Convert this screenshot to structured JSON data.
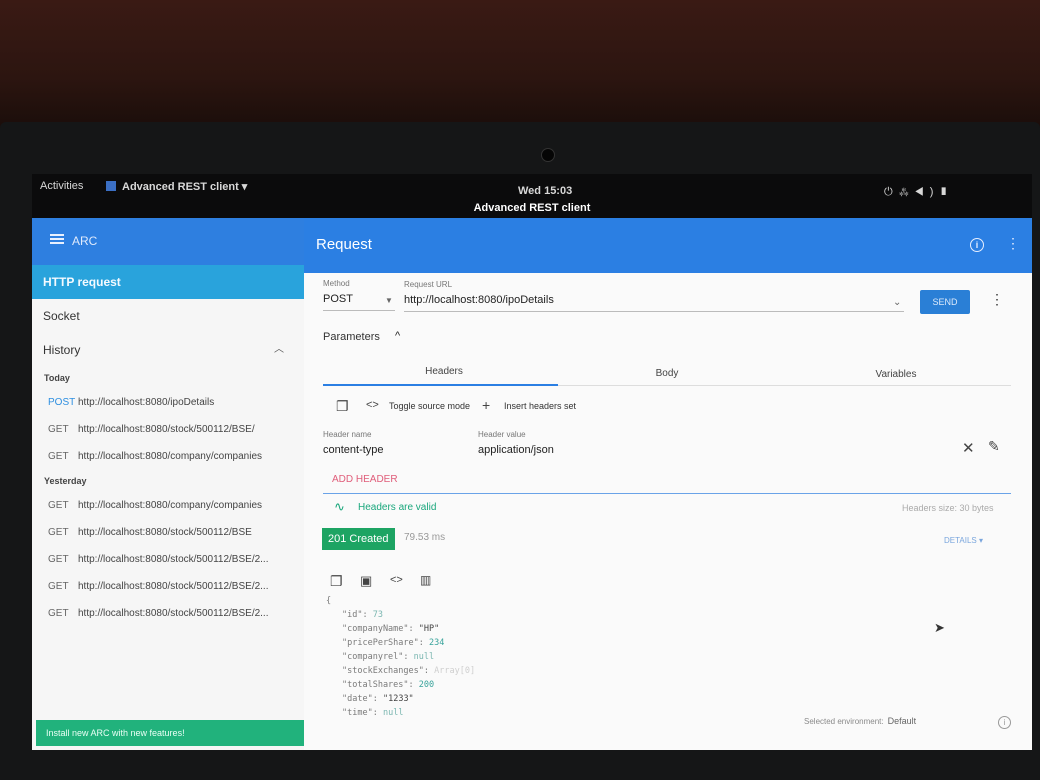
{
  "system_bar": {
    "activities": "Activities",
    "app_menu": "Advanced REST client ▾",
    "clock": "Wed 15:03",
    "window_title": "Advanced REST client",
    "tray_icons": [
      "power-icon",
      "network-icon",
      "volume-icon",
      "battery-icon"
    ]
  },
  "sidebar": {
    "brand": "ARC",
    "items": [
      {
        "label": "HTTP request",
        "active": true
      },
      {
        "label": "Socket",
        "active": false
      }
    ],
    "history_label": "History",
    "groups": [
      {
        "label": "Today",
        "rows": [
          {
            "method": "POST",
            "url": "http://localhost:8080/ipoDetails"
          },
          {
            "method": "GET",
            "url": "http://localhost:8080/stock/500112/BSE/"
          },
          {
            "method": "GET",
            "url": "http://localhost:8080/company/companies"
          }
        ]
      },
      {
        "label": "Yesterday",
        "rows": [
          {
            "method": "GET",
            "url": "http://localhost:8080/company/companies"
          },
          {
            "method": "GET",
            "url": "http://localhost:8080/stock/500112/BSE"
          },
          {
            "method": "GET",
            "url": "http://localhost:8080/stock/500112/BSE/2..."
          },
          {
            "method": "GET",
            "url": "http://localhost:8080/stock/500112/BSE/2..."
          },
          {
            "method": "GET",
            "url": "http://localhost:8080/stock/500112/BSE/2..."
          }
        ]
      }
    ],
    "footer": "Install new ARC with new features!"
  },
  "request": {
    "title": "Request",
    "method_label": "Method",
    "method": "POST",
    "url_label": "Request URL",
    "url": "http://localhost:8080/ipoDetails",
    "send": "SEND",
    "parameters": "Parameters",
    "tabs": [
      "Headers",
      "Body",
      "Variables"
    ],
    "toolbar": {
      "toggle": "Toggle source mode",
      "insert": "Insert headers set"
    },
    "header_name_label": "Header name",
    "header_name": "content-type",
    "header_value_label": "Header value",
    "header_value": "application/json",
    "add_header": "ADD HEADER",
    "valid_msg": "Headers are valid",
    "headers_size": "Headers size: 30 bytes"
  },
  "response": {
    "status": "201 Created",
    "time": "79.53 ms",
    "details": "DETAILS ▾",
    "json_lines": [
      {
        "t": "{",
        "cls": ""
      },
      {
        "k": "\"id\"",
        "v": "73",
        "vc": "nl"
      },
      {
        "k": "\"companyName\"",
        "v": "\"HP\"",
        "vc": "s"
      },
      {
        "k": "\"pricePerShare\"",
        "v": "234",
        "vc": "n"
      },
      {
        "k": "\"companyrel\"",
        "v": "null",
        "vc": "nl"
      },
      {
        "k": "\"stockExchanges\"",
        "v": "Array[0]",
        "vc": "dim"
      },
      {
        "k": "\"totalShares\"",
        "v": "200",
        "vc": "n"
      },
      {
        "k": "\"date\"",
        "v": "\"1233\"",
        "vc": "s"
      },
      {
        "k": "\"time\"",
        "v": "null",
        "vc": "nl"
      }
    ]
  },
  "footer": {
    "env_label": "Selected environment:",
    "env_value": "Default"
  },
  "colors": {
    "header_blue": "#2b7fe3",
    "sidebar_active": "#29a3dc",
    "status_green": "#1da463",
    "footer_green": "#21b27c"
  }
}
